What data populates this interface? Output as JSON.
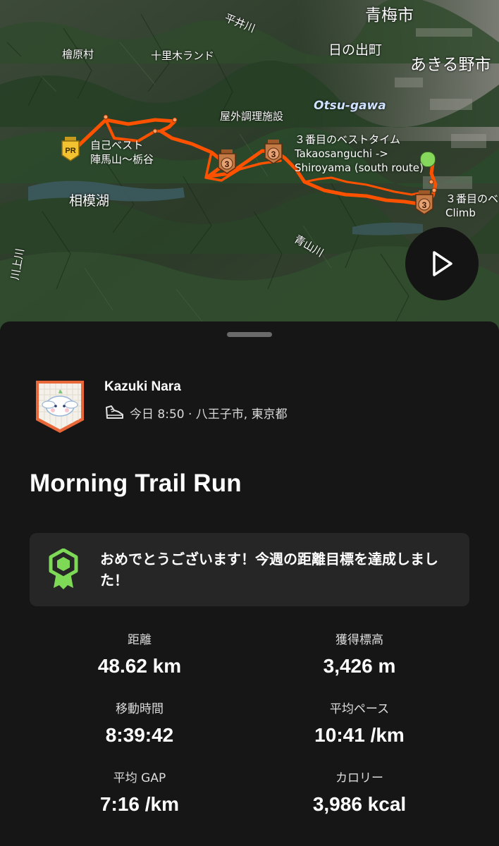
{
  "map": {
    "place_labels": {
      "ome": "青梅市",
      "hinodemachi": "日の出町",
      "akiruno": "あきる野市",
      "hinohara": "檜原村",
      "juriki": "十里木ランド",
      "okugai": "屋外調理施設",
      "sagamiko": "相模湖",
      "heiigawa": "平井川",
      "kawakami": "川上川",
      "aoyamagawa": "青山川",
      "otsugawa": "Otsu-gawa"
    },
    "segments": {
      "pr_label_line1": "自己ベスト",
      "pr_label_line2": "陣馬山〜栃谷",
      "third_label_line1": "３番目のベストタイム",
      "third_label_line2": "Takaosanguchi ->",
      "third_label_line3": "Shiroyama (south route)",
      "right_label_line1": "３番目のベ",
      "right_label_line2": "Climb"
    },
    "medals": {
      "pr": "PR",
      "third": "3"
    },
    "route_color": "#fc5200",
    "start_color": "#86d85d",
    "play_icon": "play-icon"
  },
  "athlete": {
    "name": "Kazuki Nara",
    "meta": "今日 8:50 · 八王子市, 東京都",
    "activity_icon": "running-shoe-icon"
  },
  "activity": {
    "title": "Morning Trail Run"
  },
  "goal": {
    "text": "おめでとうございます！今週の距離目標を達成しました！",
    "icon": "achievement-badge-icon",
    "icon_color": "#7ed957"
  },
  "stats": [
    {
      "label": "距離",
      "value": "48.62 km"
    },
    {
      "label": "獲得標高",
      "value": "3,426 m"
    },
    {
      "label": "移動時間",
      "value": "8:39:42"
    },
    {
      "label": "平均ペース",
      "value": "10:41 /km"
    },
    {
      "label": "平均 GAP",
      "value": "7:16 /km"
    },
    {
      "label": "カロリー",
      "value": "3,986 kcal"
    }
  ]
}
